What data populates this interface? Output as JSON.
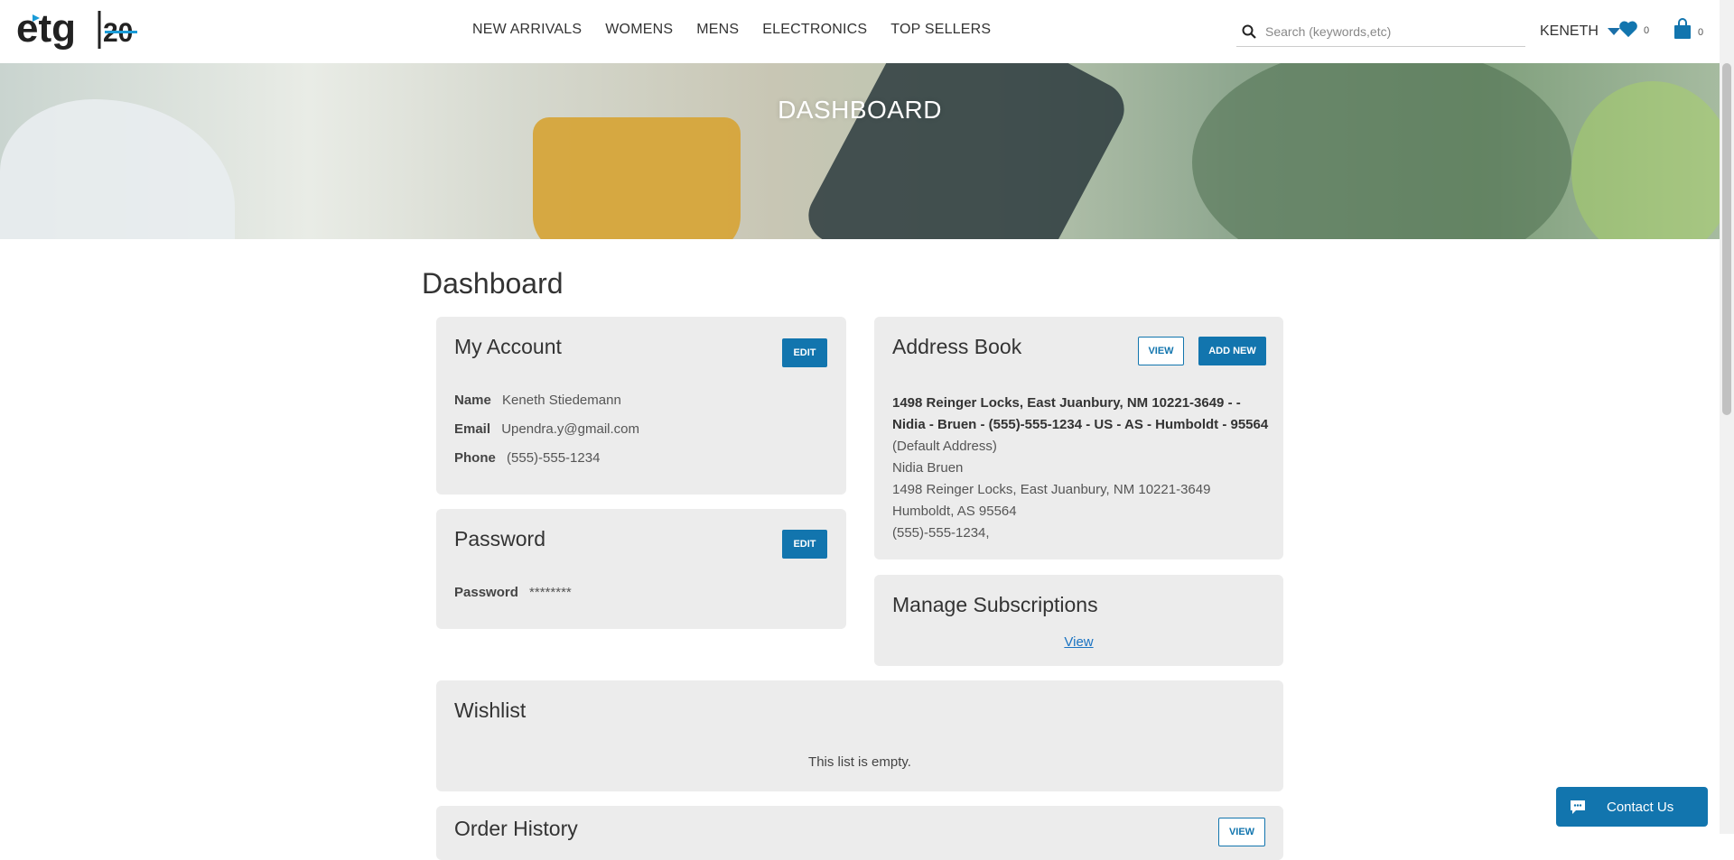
{
  "header": {
    "logo_alt": "etg 20",
    "nav": [
      "NEW ARRIVALS",
      "WOMENS",
      "MENS",
      "ELECTRONICS",
      "TOP SELLERS"
    ],
    "search_placeholder": "Search (keywords,etc)",
    "user_name": "KENETH",
    "wishlist_count": "0",
    "cart_count": "0",
    "accent": "#1275ae"
  },
  "hero": {
    "title": "DASHBOARD"
  },
  "main": {
    "title": "Dashboard",
    "account": {
      "heading": "My Account",
      "edit": "EDIT",
      "name_label": "Name",
      "name": "Keneth Stiedemann",
      "email_label": "Email",
      "email": "Upendra.y@gmail.com",
      "phone_label": "Phone",
      "phone": "(555)-555-1234"
    },
    "password": {
      "heading": "Password",
      "edit": "EDIT",
      "label": "Password",
      "value": "********"
    },
    "address_book": {
      "heading": "Address Book",
      "view": "VIEW",
      "add_new": "ADD NEW",
      "summary": "1498 Reinger Locks, East Juanbury, NM 10221-3649 - - Nidia - Bruen - (555)-555-1234 - US - AS - Humboldt - 95564",
      "default_label": "(Default Address)",
      "name": "Nidia  Bruen",
      "street": "1498 Reinger Locks, East Juanbury, NM 10221-3649",
      "city": "Humboldt,  AS  95564",
      "phone": "(555)-555-1234,"
    },
    "subscriptions": {
      "heading": "Manage Subscriptions",
      "view": "View"
    },
    "wishlist": {
      "heading": "Wishlist",
      "empty": "This list is empty."
    },
    "orders": {
      "heading": "Order History",
      "view": "VIEW"
    }
  },
  "contact": {
    "label": "Contact Us"
  }
}
